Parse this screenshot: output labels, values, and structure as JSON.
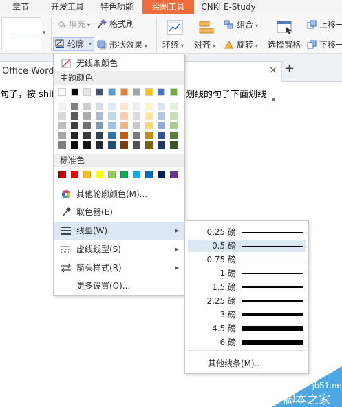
{
  "ribbon_tabs": [
    "章节",
    "开发工具",
    "特色功能",
    "绘图工具",
    "CNKI E-Study"
  ],
  "active_tab": "绘图工具",
  "colors": {
    "accent": "#f26b3a",
    "highlight": "#dde8f5",
    "tab_bg": "#eef2f6"
  },
  "toolbar": {
    "fill": "填充",
    "format_painter": "格式刷",
    "outline": "轮廓",
    "shape_effects": "形状效果",
    "wrap": "环绕",
    "align": "对齐",
    "group": "组合",
    "rotate": "旋转",
    "selection_pane": "选择窗格",
    "bring_forward": "上移一",
    "send_backward": "下移一"
  },
  "doc_tab": {
    "title": "Office Word 2",
    "close": "×",
    "add": "+"
  },
  "document": {
    "line_part1": "句子，按 shift",
    "line_part2": "划线的句子下面划线"
  },
  "outline_menu": {
    "no_line": "无线条颜色",
    "theme_colors_label": "主题颜色",
    "standard_colors_label": "标准色",
    "more_colors": "其他轮廓颜色(M)...",
    "eyedropper": "取色器(E)",
    "line_weight": "线型(W)",
    "dash_type": "虚线线型(S)",
    "arrow_style": "箭头样式(R)",
    "more_settings": "更多设置(O)..."
  },
  "theme_colors": {
    "top": [
      "#ffffff",
      "#000000",
      "#e7e6e6",
      "#44546a",
      "#5b9bd5",
      "#ed7d31",
      "#a5a5a5",
      "#ffc000",
      "#4472c4",
      "#70ad47"
    ],
    "shades": [
      [
        "#f2f2f2",
        "#7f7f7f",
        "#d0cece",
        "#d6dce4",
        "#deebf6",
        "#fbe5d5",
        "#ededed",
        "#fff2cc",
        "#dae3f3",
        "#e2efd9"
      ],
      [
        "#d8d8d8",
        "#595959",
        "#aeabab",
        "#adb9ca",
        "#bdd7ee",
        "#f7cbac",
        "#dbdbdb",
        "#fee599",
        "#b4c6e7",
        "#c5e0b3"
      ],
      [
        "#bfbfbf",
        "#3f3f3f",
        "#757070",
        "#8496b0",
        "#9dc3e6",
        "#f4b183",
        "#c9c9c9",
        "#ffd965",
        "#8faadc",
        "#a8d08d"
      ],
      [
        "#a5a5a5",
        "#262626",
        "#3a3838",
        "#323f4f",
        "#2e75b5",
        "#c55a11",
        "#7b7b7b",
        "#bf9000",
        "#2f5496",
        "#538135"
      ],
      [
        "#7f7f7f",
        "#0c0c0c",
        "#171616",
        "#222a35",
        "#1e4e79",
        "#833c0b",
        "#525252",
        "#7f6000",
        "#1f3864",
        "#375623"
      ]
    ]
  },
  "standard_colors": [
    "#c00000",
    "#ff0000",
    "#ffc000",
    "#ffff00",
    "#92d050",
    "#00b050",
    "#00b0f0",
    "#0070c0",
    "#002060",
    "#7030a0"
  ],
  "weights": [
    {
      "label": "0.25 磅",
      "pt": 0.25
    },
    {
      "label": "0.5 磅",
      "pt": 0.5
    },
    {
      "label": "0.75 磅",
      "pt": 0.75
    },
    {
      "label": "1 磅",
      "pt": 1
    },
    {
      "label": "1.5 磅",
      "pt": 1.5
    },
    {
      "label": "2.25 磅",
      "pt": 2.25
    },
    {
      "label": "3 磅",
      "pt": 3
    },
    {
      "label": "4.5 磅",
      "pt": 4.5
    },
    {
      "label": "6 磅",
      "pt": 6
    }
  ],
  "selected_weight": "0.5 磅",
  "other_weights": "其他线条(M)...",
  "watermark": {
    "site": "jb51.net",
    "name": "脚本之家"
  }
}
